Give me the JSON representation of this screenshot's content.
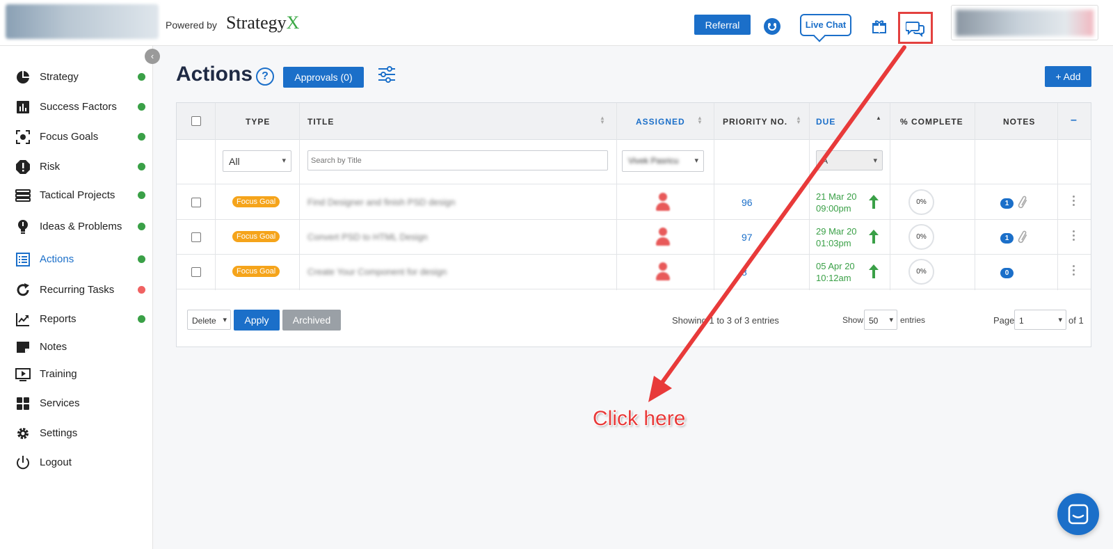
{
  "header": {
    "powered_by": "Powered by",
    "brand_name": "Strategy",
    "brand_x": "X",
    "referral_label": "Referral",
    "live_chat_label": "Live Chat",
    "icons": [
      "smiley-icon",
      "gift-icon",
      "chat-icon"
    ]
  },
  "sidebar": {
    "collapse_glyph": "‹",
    "items": [
      {
        "label": "Strategy",
        "icon": "pie-chart-icon",
        "status": "#3aa047"
      },
      {
        "label": "Success Factors",
        "icon": "bar-chart-icon",
        "status": "#3aa047"
      },
      {
        "label": "Focus Goals",
        "icon": "focus-icon",
        "status": "#3aa047"
      },
      {
        "label": "Risk",
        "icon": "alert-icon",
        "status": "#3aa047"
      },
      {
        "label": "Tactical Projects",
        "icon": "stack-icon",
        "status": "#3aa047"
      },
      {
        "label": "Ideas & Problems",
        "icon": "lightbulb-icon",
        "status": "#3aa047"
      },
      {
        "label": "Actions",
        "icon": "list-icon",
        "status": "#3aa047",
        "active": true
      },
      {
        "label": "Recurring Tasks",
        "icon": "refresh-icon",
        "status": "#f06262"
      },
      {
        "label": "Reports",
        "icon": "trend-icon",
        "status": "#3aa047"
      },
      {
        "label": "Notes",
        "icon": "note-icon"
      },
      {
        "label": "Training",
        "icon": "play-icon"
      },
      {
        "label": "Services",
        "icon": "grid-icon"
      },
      {
        "label": "Settings",
        "icon": "gear-icon"
      },
      {
        "label": "Logout",
        "icon": "power-icon"
      }
    ]
  },
  "main": {
    "title": "Actions",
    "help_glyph": "?",
    "approvals_label": "Approvals  (0)",
    "add_label": "+ Add"
  },
  "table": {
    "headers": {
      "type": "TYPE",
      "title": "TITLE",
      "assigned": "ASSIGNED",
      "priority": "PRIORITY NO.",
      "due": "DUE",
      "complete": "% COMPLETE",
      "notes": "NOTES",
      "collapse": "–"
    },
    "filters": {
      "type_value": "All",
      "title_placeholder": "Search by Title",
      "assigned_value": "Vivek Pasricu",
      "due_value": "A"
    },
    "rows": [
      {
        "type": "Focus Goal",
        "title": "Find Designer and finish PSD design",
        "priority": "96",
        "due_date": "21 Mar 20",
        "due_time": "09:00pm",
        "complete": "0%",
        "notes": "1",
        "attachment": true
      },
      {
        "type": "Focus Goal",
        "title": "Convert PSD to HTML Design",
        "priority": "97",
        "due_date": "29 Mar 20",
        "due_time": "01:03pm",
        "complete": "0%",
        "notes": "1",
        "attachment": true
      },
      {
        "type": "Focus Goal",
        "title": "Create Your Component for design",
        "priority": "8",
        "due_date": "05 Apr 20",
        "due_time": "10:12am",
        "complete": "0%",
        "notes": "0",
        "attachment": false
      }
    ],
    "footer": {
      "bulk_action": "Delete",
      "apply_label": "Apply",
      "archived_label": "Archived",
      "showing": "Showing 1 to 3 of 3 entries",
      "show_label": "Show",
      "page_size": "50",
      "entries_label": "entries",
      "page_label": "Page",
      "page_value": "1",
      "of_label": "of 1"
    }
  },
  "annotation": {
    "text": "Click here",
    "color": "#e83a3a"
  },
  "colors": {
    "accent": "#1b6fc9",
    "success": "#3aa047",
    "badge": "#f5a41b"
  }
}
